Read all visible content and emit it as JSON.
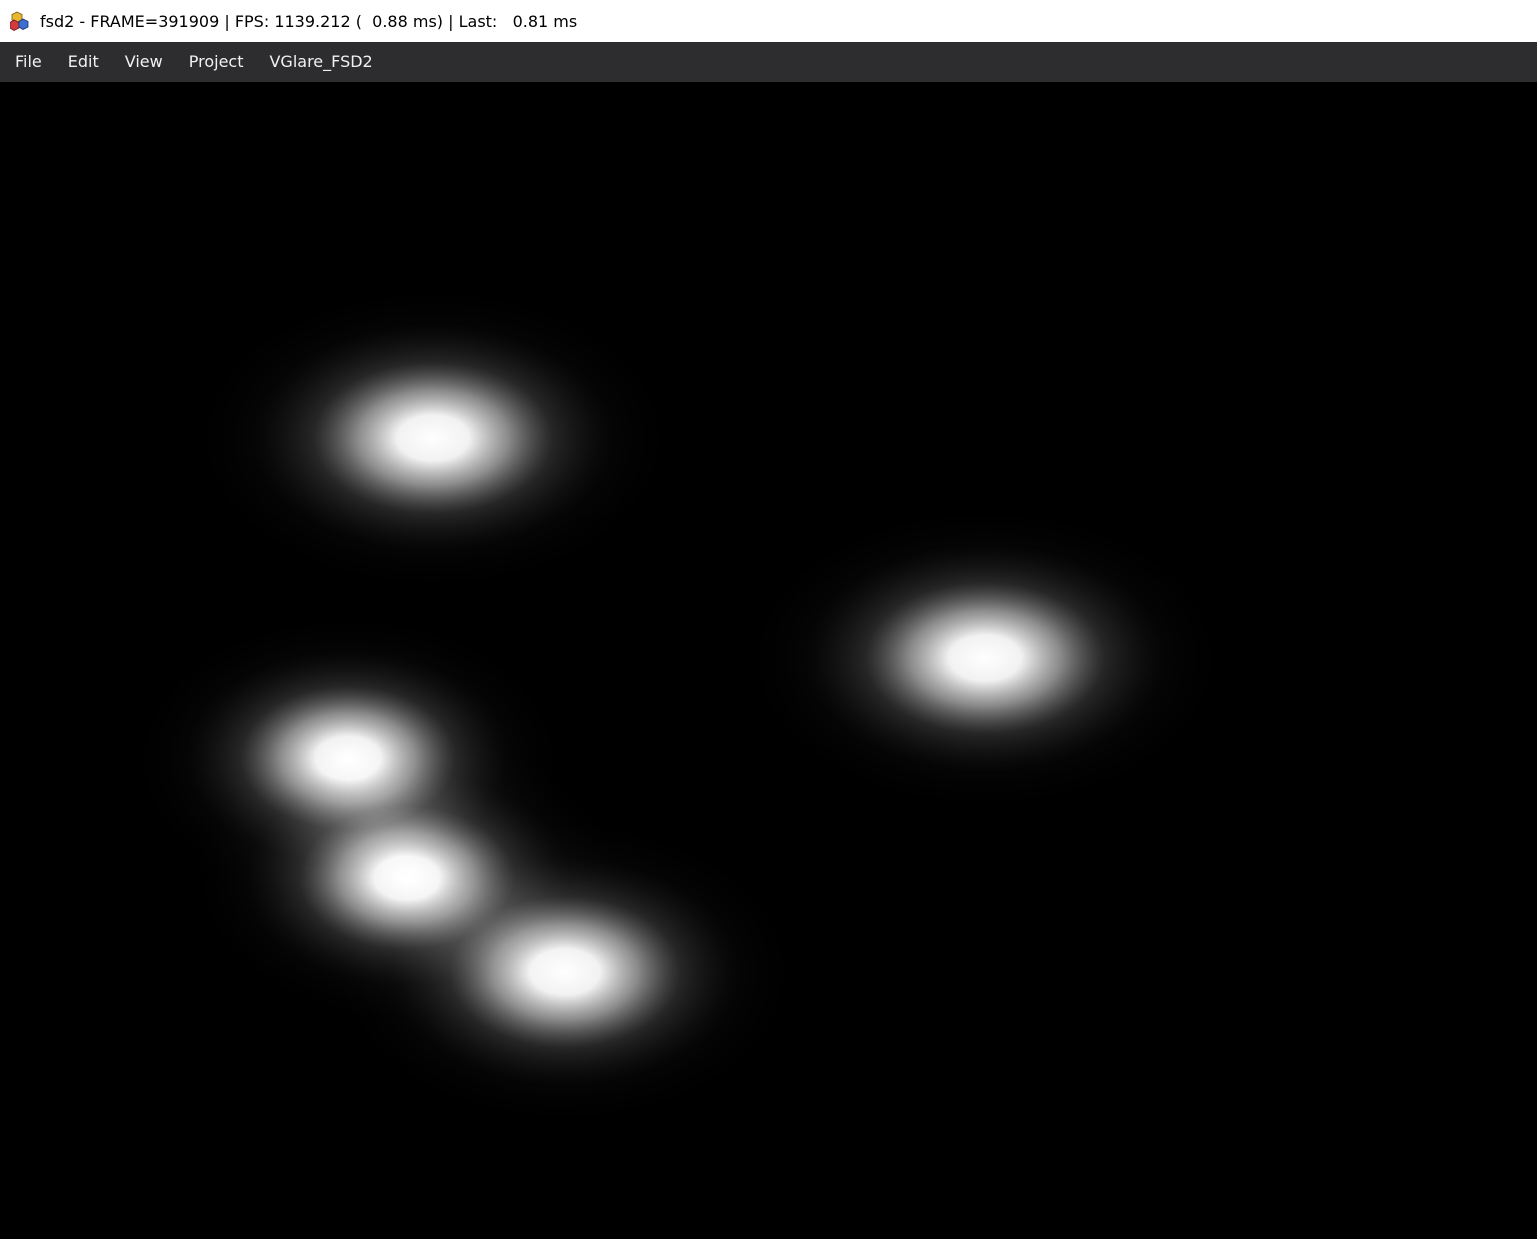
{
  "window": {
    "title": "fsd2 - FRAME=391909 | FPS: 1139.212 (  0.88 ms) | Last:   0.81 ms",
    "icon": "app-cubes-icon"
  },
  "menubar": {
    "items": [
      {
        "label": "File"
      },
      {
        "label": "Edit"
      },
      {
        "label": "View"
      },
      {
        "label": "Project"
      },
      {
        "label": "VGlare_FSD2"
      }
    ]
  },
  "viewport": {
    "background_color": "#000000",
    "glow_color": "#ffffff",
    "glow_count": 5
  }
}
